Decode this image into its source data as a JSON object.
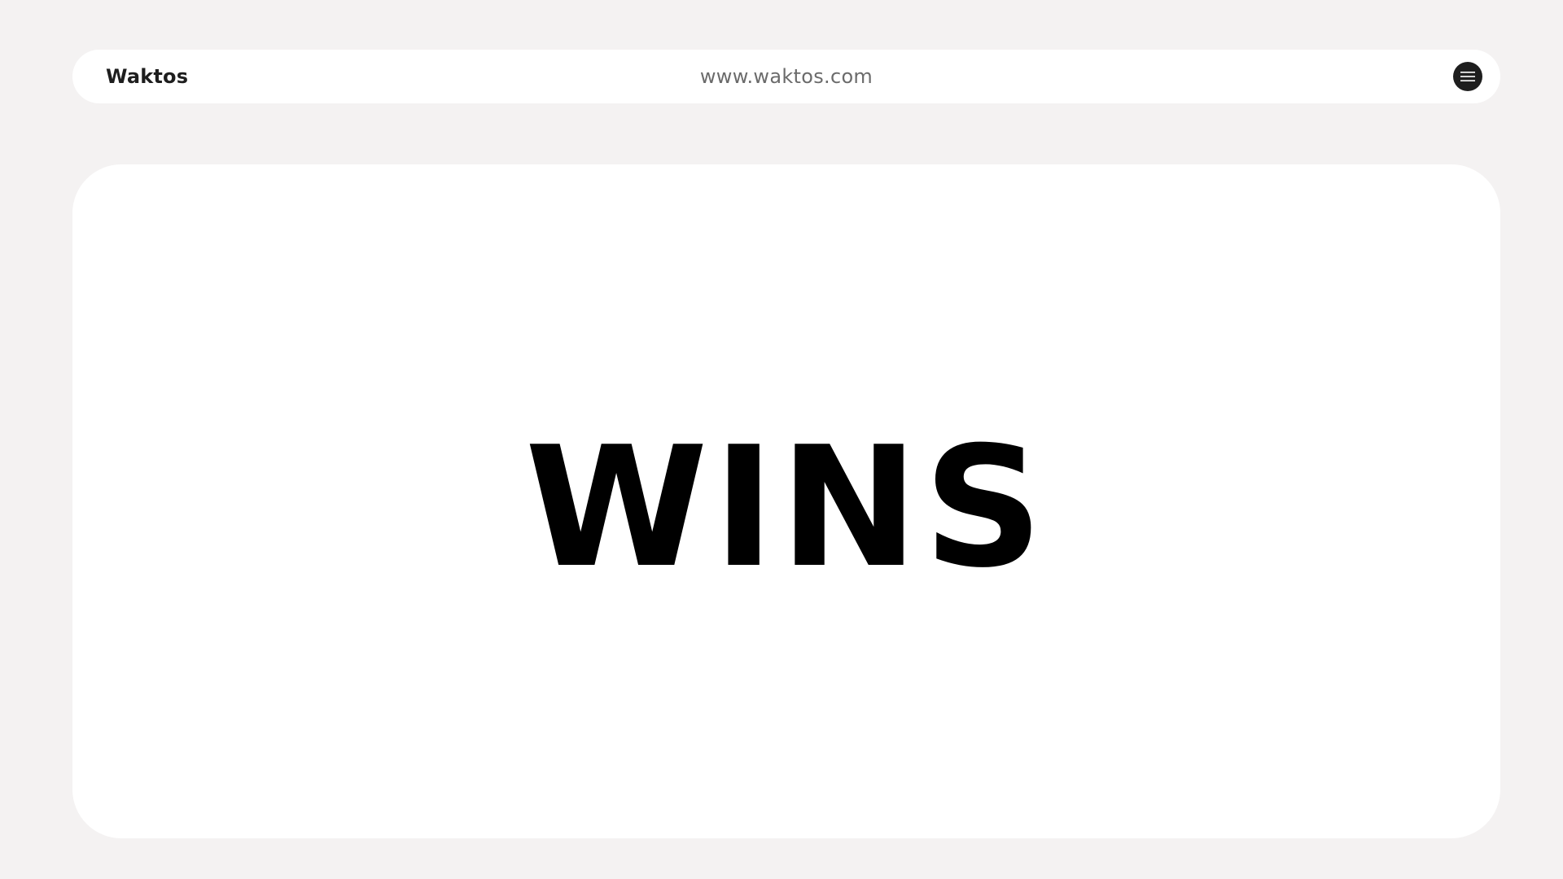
{
  "header": {
    "brand": "Waktos",
    "url": "www.waktos.com",
    "menu_icon": "hamburger-menu-icon"
  },
  "main": {
    "headline": "WINS"
  },
  "colors": {
    "background": "#f4f2f2",
    "surface": "#ffffff",
    "text_dark": "#1e1e1e",
    "text_muted": "#6b6b6b",
    "headline": "#000000"
  }
}
